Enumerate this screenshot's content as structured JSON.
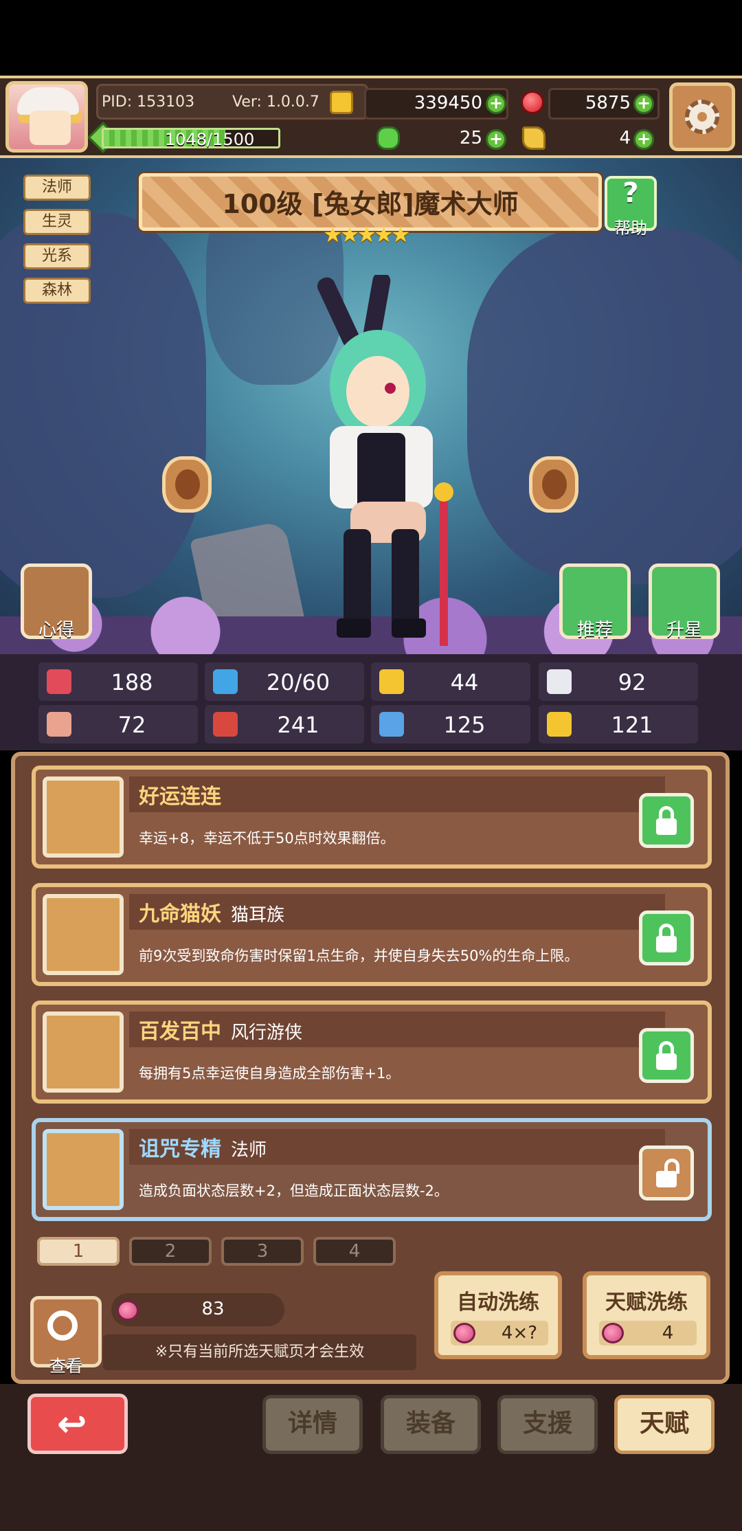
{
  "header": {
    "pid": "PID: 153103",
    "version": "Ver: 1.0.0.7",
    "gold": "339450",
    "gems": "5875",
    "clover": "25",
    "keys": "4",
    "xp_text": "1048/1500",
    "xp_progress": 0.698
  },
  "tags": [
    "法师",
    "生灵",
    "光系",
    "森林"
  ],
  "character": {
    "title": "100级 [兔女郎]魔术大师",
    "stars": "★★★★★",
    "star_count": 5
  },
  "buttons": {
    "help": "帮助",
    "insight": "心得",
    "recommend": "推荐",
    "star_up": "升星",
    "view": "查看",
    "auto_wash": "自动洗练",
    "auto_wash_cost": "4×?",
    "talent_wash": "天赋洗练",
    "talent_wash_cost": "4"
  },
  "stats": [
    {
      "icon": "heart-icon",
      "value": "188",
      "color": "#e24b5a"
    },
    {
      "icon": "mana-drop-icon",
      "value": "20/60",
      "color": "#42a6e6"
    },
    {
      "icon": "shield-icon",
      "value": "44",
      "color": "#f4c531"
    },
    {
      "icon": "wing-icon",
      "value": "92",
      "color": "#e9e9f0"
    },
    {
      "icon": "fist-icon",
      "value": "72",
      "color": "#e9a38f"
    },
    {
      "icon": "spellbook-icon",
      "value": "241",
      "color": "#d9483f"
    },
    {
      "icon": "boot-icon",
      "value": "125",
      "color": "#5aa3e6"
    },
    {
      "icon": "horseshoe-icon",
      "value": "121",
      "color": "#f4c531"
    }
  ],
  "talents": [
    {
      "name": "好运连连",
      "class": "",
      "desc": "幸运+8，幸运不低于50点时效果翻倍。",
      "locked": true,
      "active": false
    },
    {
      "name": "九命猫妖",
      "class": "猫耳族",
      "desc": "前9次受到致命伤害时保留1点生命，并使自身失去50%的生命上限。",
      "locked": true,
      "active": false
    },
    {
      "name": "百发百中",
      "class": "风行游侠",
      "desc": "每拥有5点幸运使自身造成全部伤害+1。",
      "locked": true,
      "active": false
    },
    {
      "name": "诅咒专精",
      "class": "法师",
      "desc": "造成负面状态层数+2，但造成正面状态层数-2。",
      "locked": false,
      "active": true
    }
  ],
  "pages": [
    "1",
    "2",
    "3",
    "4"
  ],
  "selected_page": "1",
  "apple_count": "83",
  "note": "※只有当前所选天赋页才会生效",
  "nav": {
    "detail": "详情",
    "equip": "装备",
    "support": "支援",
    "talent": "天赋"
  }
}
